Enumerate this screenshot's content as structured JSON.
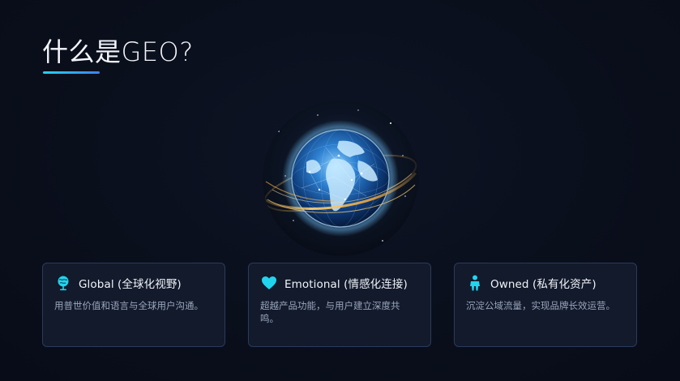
{
  "title": "什么是GEO?",
  "accent_color": "#22d3ee",
  "globe": {
    "icon": "earth-globe-with-rings-image"
  },
  "cards": [
    {
      "icon": "globe-icon",
      "title": "Global (全球化视野)",
      "description": "用普世价值和语言与全球用户沟通。"
    },
    {
      "icon": "heart-icon",
      "title": "Emotional (情感化连接)",
      "description": "超越产品功能，与用户建立深度共鸣。"
    },
    {
      "icon": "person-icon",
      "title": "Owned (私有化资产)",
      "description": "沉淀公域流量，实现品牌长效运营。"
    }
  ]
}
